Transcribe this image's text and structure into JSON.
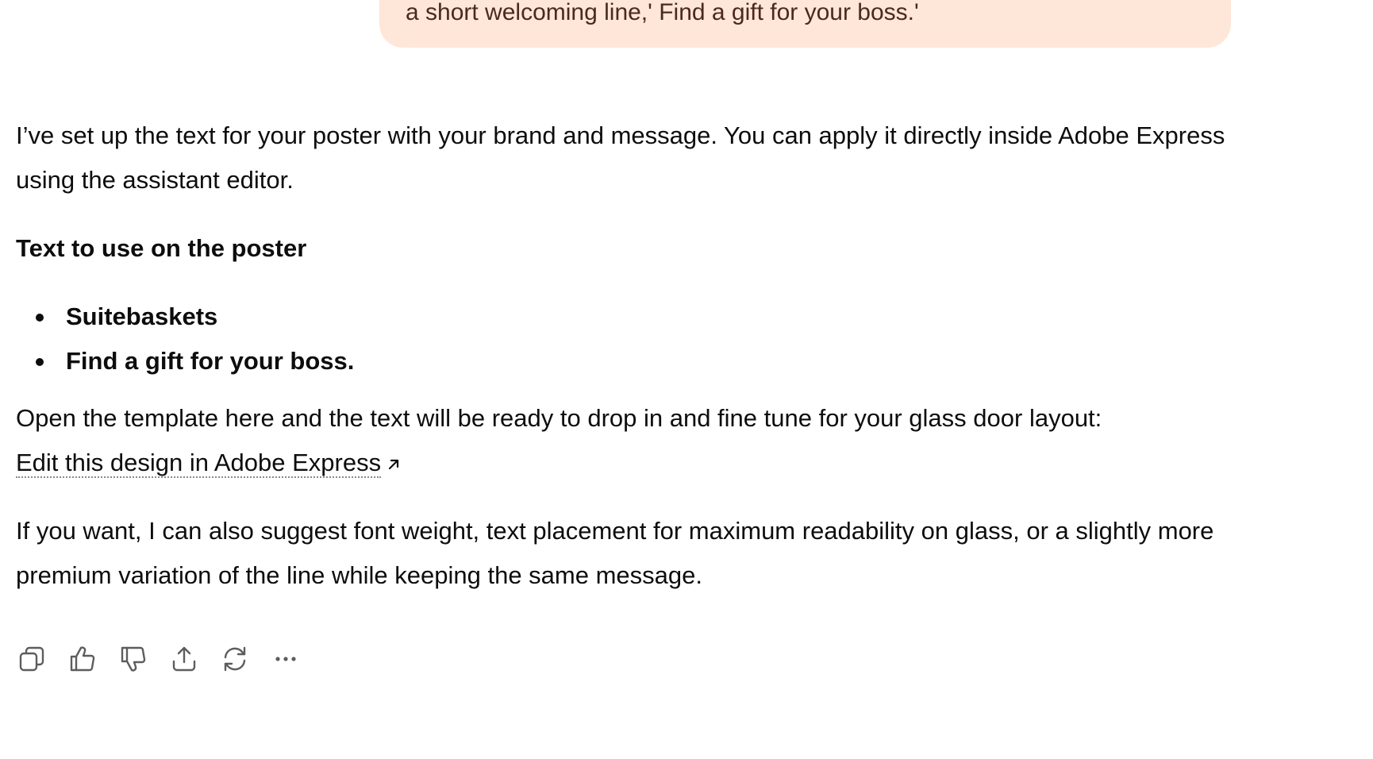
{
  "user_message": {
    "text": "a short welcoming line,' Find a gift for your boss.'"
  },
  "assistant_message": {
    "intro": "I’ve set up the text for your poster with your brand and message. You can apply it directly inside Adobe Express using the assistant editor.",
    "heading": "Text to use on the poster",
    "bullets": [
      "Suitebaskets",
      "Find a gift for your boss."
    ],
    "open_text": "Open the template here and the text will be ready to drop in and fine tune for your glass door layout:",
    "link_label": "Edit this design in Adobe Express",
    "closing": "If you want, I can also suggest font weight, text placement for maximum readability on glass, or a slightly more premium variation of the line while keeping the same message."
  },
  "action_bar": {
    "icons": [
      "copy-icon",
      "thumbs-up-icon",
      "thumbs-down-icon",
      "share-icon",
      "regenerate-icon",
      "more-icon"
    ]
  },
  "colors": {
    "user_bubble": "#fee6d8",
    "user_text": "#4a2a1c",
    "text": "#0d0d0d",
    "icon": "#5d5d5d"
  }
}
